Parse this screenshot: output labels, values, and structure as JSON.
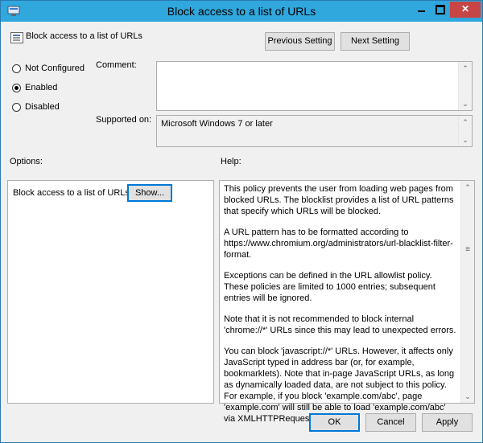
{
  "window": {
    "title": "Block access to a list of URLs"
  },
  "header": {
    "policy_name": "Block access to a list of URLs",
    "previous_label": "Previous Setting",
    "next_label": "Next Setting"
  },
  "state": {
    "options": [
      {
        "label": "Not Configured",
        "selected": false
      },
      {
        "label": "Enabled",
        "selected": true
      },
      {
        "label": "Disabled",
        "selected": false
      }
    ]
  },
  "comment": {
    "label": "Comment:",
    "value": ""
  },
  "supported": {
    "label": "Supported on:",
    "value": "Microsoft Windows 7 or later"
  },
  "options_section": {
    "label": "Options:",
    "row_label": "Block access to a list of URLs",
    "show_label": "Show..."
  },
  "help_section": {
    "label": "Help:",
    "paragraphs": [
      "This policy prevents the user from loading web pages from blocked URLs. The blocklist provides a list of URL patterns that specify which URLs will be blocked.",
      "A URL pattern has to be formatted according to https://www.chromium.org/administrators/url-blacklist-filter-format.",
      "Exceptions can be defined in the URL allowlist policy. These policies are limited to 1000 entries; subsequent entries will be ignored.",
      "Note that it is not recommended to block internal 'chrome://*' URLs since this may lead to unexpected errors.",
      "You can block 'javascript://*' URLs. However, it affects only JavaScript typed in address bar (or, for example, bookmarklets). Note that in-page JavaScript URLs, as long as dynamically loaded data, are not subject to this policy. For example, if you block 'example.com/abc', page 'example.com' will still be able to load 'example.com/abc' via XMLHTTPRequest."
    ]
  },
  "footer": {
    "ok_label": "OK",
    "cancel_label": "Cancel",
    "apply_label": "Apply"
  },
  "colors": {
    "titlebar": "#30a7dd",
    "close": "#c74545",
    "focus": "#0078d7"
  }
}
